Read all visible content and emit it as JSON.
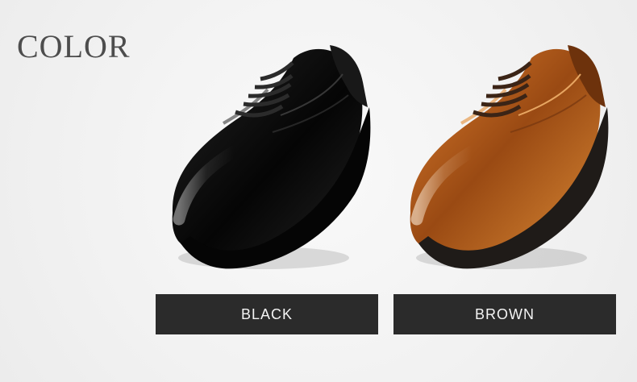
{
  "heading": {
    "title": "COLOR"
  },
  "colors": {
    "background": "#f2f2f2",
    "label_background": "#2b2b2b",
    "label_text": "#f4f4f4",
    "black_shoe": "#111111",
    "brown_shoe": "#b8621f"
  },
  "options": [
    {
      "label": "BLACK",
      "icon": "black-dress-shoe"
    },
    {
      "label": "BROWN",
      "icon": "brown-dress-shoe"
    }
  ]
}
